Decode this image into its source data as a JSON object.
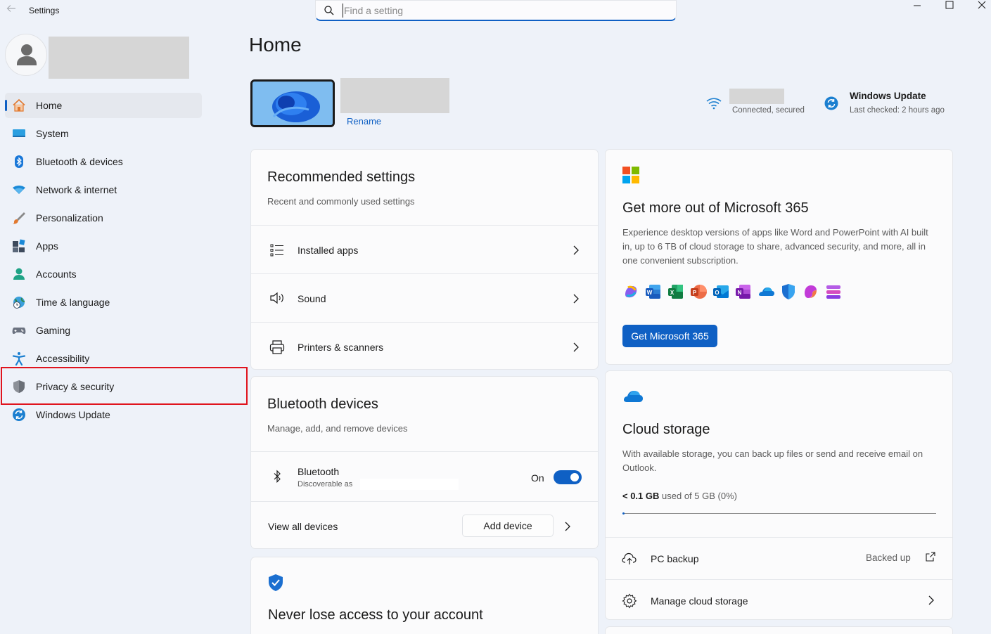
{
  "window": {
    "title": "Settings",
    "controls": {
      "minimize": "—",
      "maximize": "☐",
      "close": "✕"
    }
  },
  "search": {
    "placeholder": "Find a setting"
  },
  "sidebar": {
    "items": [
      {
        "label": "Home",
        "icon": "home-icon",
        "active": true
      },
      {
        "label": "System",
        "icon": "system-icon"
      },
      {
        "label": "Bluetooth & devices",
        "icon": "bluetooth-icon"
      },
      {
        "label": "Network & internet",
        "icon": "network-icon"
      },
      {
        "label": "Personalization",
        "icon": "brush-icon"
      },
      {
        "label": "Apps",
        "icon": "apps-icon"
      },
      {
        "label": "Accounts",
        "icon": "accounts-icon"
      },
      {
        "label": "Time & language",
        "icon": "time-language-icon"
      },
      {
        "label": "Gaming",
        "icon": "gamepad-icon"
      },
      {
        "label": "Accessibility",
        "icon": "accessibility-icon"
      },
      {
        "label": "Privacy & security",
        "icon": "shield-icon"
      },
      {
        "label": "Windows Update",
        "icon": "windows-update-icon"
      }
    ]
  },
  "main": {
    "title": "Home",
    "device": {
      "rename": "Rename"
    },
    "network": {
      "status": "Connected, secured"
    },
    "windows_update": {
      "title": "Windows Update",
      "subtitle": "Last checked: 2 hours ago"
    },
    "recommended": {
      "title": "Recommended settings",
      "subtitle": "Recent and commonly used settings",
      "rows": [
        {
          "label": "Installed apps",
          "icon": "list-icon"
        },
        {
          "label": "Sound",
          "icon": "speaker-icon"
        },
        {
          "label": "Printers & scanners",
          "icon": "printer-icon"
        }
      ]
    },
    "bluetooth": {
      "title": "Bluetooth devices",
      "subtitle": "Manage, add, and remove devices",
      "device_label": "Bluetooth",
      "device_sub": "Discoverable as",
      "toggle_label": "On",
      "toggle_on": true,
      "view_all": "View all devices",
      "add_device": "Add device"
    },
    "account": {
      "title": "Never lose access to your account"
    },
    "m365": {
      "title": "Get more out of Microsoft 365",
      "description": "Experience desktop versions of apps like Word and PowerPoint with AI built in, up to 6 TB of cloud storage to share, advanced security, and more, all in one convenient subscription.",
      "button": "Get Microsoft 365",
      "button_color": "#0f60c4",
      "apps": [
        "copilot-icon",
        "word-icon",
        "excel-icon",
        "powerpoint-icon",
        "outlook-icon",
        "onenote-icon",
        "onedrive-icon",
        "defender-icon",
        "clipchamp-icon",
        "designer-icon"
      ]
    },
    "cloud": {
      "title": "Cloud storage",
      "description": "With available storage, you can back up files or send and receive email on Outlook.",
      "used": "< 0.1 GB",
      "used_rest": "used of 5 GB (0%)",
      "progress_percent": 0,
      "rows": [
        {
          "label": "PC backup",
          "status": "Backed up",
          "icon": "cloud-upload-icon"
        },
        {
          "label": "Manage cloud storage",
          "icon": "gear-icon"
        }
      ]
    }
  },
  "highlight_color": "#e0141e"
}
